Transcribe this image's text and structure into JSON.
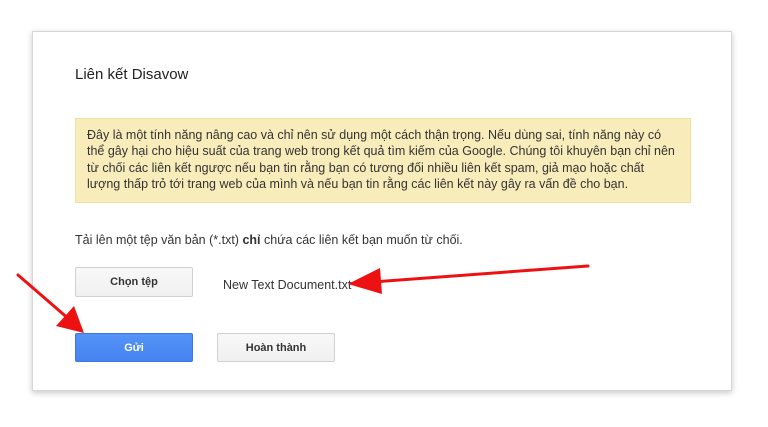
{
  "dialog": {
    "title": "Liên kết Disavow",
    "warning": "Đây là một tính năng nâng cao và chỉ nên sử dụng một cách thận trọng. Nếu dùng sai, tính năng này có thể gây hại cho hiệu suất của trang web trong kết quả tìm kiếm của Google. Chúng tôi khuyên bạn chỉ nên từ chối các liên kết ngược nếu bạn tin rằng bạn có tương đối nhiều liên kết spam, giả mạo hoặc chất lượng thấp trỏ tới trang web của mình và nếu bạn tin rằng các liên kết này gây ra vấn đề cho bạn.",
    "instruction_before": "Tải lên một tệp văn bản (*.txt) ",
    "instruction_bold": "chỉ",
    "instruction_after": " chứa các liên kết bạn muốn từ chối.",
    "choose_file_label": "Chọn tệp",
    "file_name": "New Text Document.txt",
    "submit_label": "Gửi",
    "done_label": "Hoàn thành"
  },
  "annotations": {
    "arrow_color": "#ee1111"
  }
}
